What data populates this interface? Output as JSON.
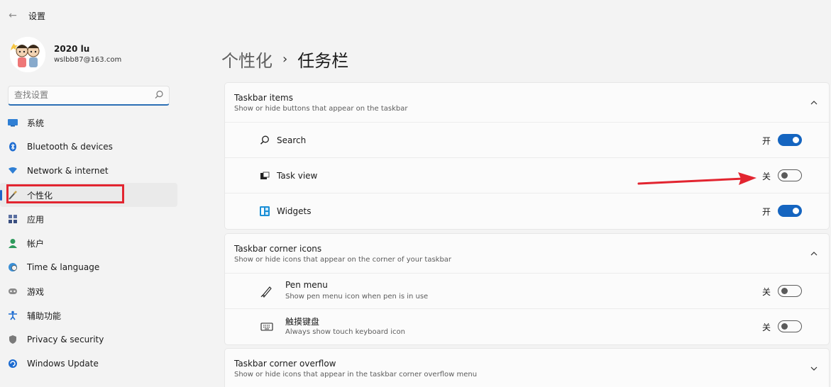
{
  "window": {
    "title": "设置"
  },
  "profile": {
    "name": "2020 lu",
    "email": "wslbb87@163.com"
  },
  "search": {
    "placeholder": "查找设置"
  },
  "sidebar": {
    "items": [
      {
        "label": "系统",
        "icon": "monitor-icon"
      },
      {
        "label": "Bluetooth & devices",
        "icon": "bluetooth-icon"
      },
      {
        "label": "Network & internet",
        "icon": "wifi-icon"
      },
      {
        "label": "个性化",
        "icon": "brush-icon",
        "active": true
      },
      {
        "label": "应用",
        "icon": "apps-icon"
      },
      {
        "label": "帐户",
        "icon": "person-icon"
      },
      {
        "label": "Time & language",
        "icon": "globe-clock-icon"
      },
      {
        "label": "游戏",
        "icon": "gamepad-icon"
      },
      {
        "label": "辅助功能",
        "icon": "accessibility-icon"
      },
      {
        "label": "Privacy & security",
        "icon": "shield-icon"
      },
      {
        "label": "Windows Update",
        "icon": "update-icon"
      }
    ]
  },
  "breadcrumb": {
    "parent": "个性化",
    "separator": "›",
    "current": "任务栏"
  },
  "sections": {
    "taskbar_items": {
      "title": "Taskbar items",
      "subtitle": "Show or hide buttons that appear on the taskbar",
      "rows": [
        {
          "label": "Search",
          "state": "开",
          "on": true,
          "icon": "search-icon"
        },
        {
          "label": "Task view",
          "state": "关",
          "on": false,
          "icon": "task-view-icon"
        },
        {
          "label": "Widgets",
          "state": "开",
          "on": true,
          "icon": "widgets-icon"
        }
      ]
    },
    "corner_icons": {
      "title": "Taskbar corner icons",
      "subtitle": "Show or hide icons that appear on the corner of your taskbar",
      "rows": [
        {
          "label": "Pen menu",
          "sub": "Show pen menu icon when pen is in use",
          "state": "关",
          "on": false,
          "icon": "pen-icon"
        },
        {
          "label": "触摸键盘",
          "sub": "Always show touch keyboard icon",
          "state": "关",
          "on": false,
          "icon": "keyboard-icon"
        }
      ]
    },
    "corner_overflow": {
      "title": "Taskbar corner overflow",
      "subtitle": "Show or hide icons that appear in the taskbar corner overflow menu"
    }
  },
  "colors": {
    "accent": "#1565c0",
    "annotation": "#e22530"
  }
}
